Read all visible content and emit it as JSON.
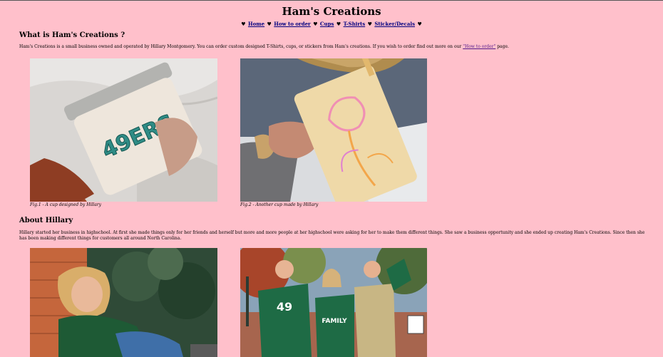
{
  "header": {
    "title": "Ham's Creations"
  },
  "nav": {
    "items": [
      {
        "label": "Home"
      },
      {
        "label": "How to order"
      },
      {
        "label": "Cups"
      },
      {
        "label": "T-Shirts"
      },
      {
        "label": "Sticker/Decals"
      }
    ],
    "separator": "♥"
  },
  "intro": {
    "heading": "What is Ham's Creations ?",
    "text_before_link": "Ham's Creations is a small business owned and operated by Hillary Montgomery. You can order custom designed T-Shirts, cups, or stickers from Ham's creations. If you wish to order find out more on our ",
    "link_text": "\"How to order\"",
    "text_after_link": " page.",
    "figures": [
      {
        "caption": "Fig.1 - A cup designed by Hillary",
        "cup_text": "49ERS"
      },
      {
        "caption": "Fig.2 - Another cup made by Hillary"
      }
    ]
  },
  "about": {
    "heading": "About Hillary",
    "text": "Hillary started her business in highschool. At first she made things only for her friends and herself but more and more people at her highschool were asking for her to make them different things. She saw a business opportunity and she ended up creating Ham's Creations. Since then she has been making different things for customers all around North Carolina.",
    "photo_text": {
      "jersey_number": "49",
      "family_shirt": "FAMILY"
    }
  },
  "colors": {
    "page_background": "#ffc0cb",
    "link": "#000080",
    "visited_link": "#551a8b"
  }
}
